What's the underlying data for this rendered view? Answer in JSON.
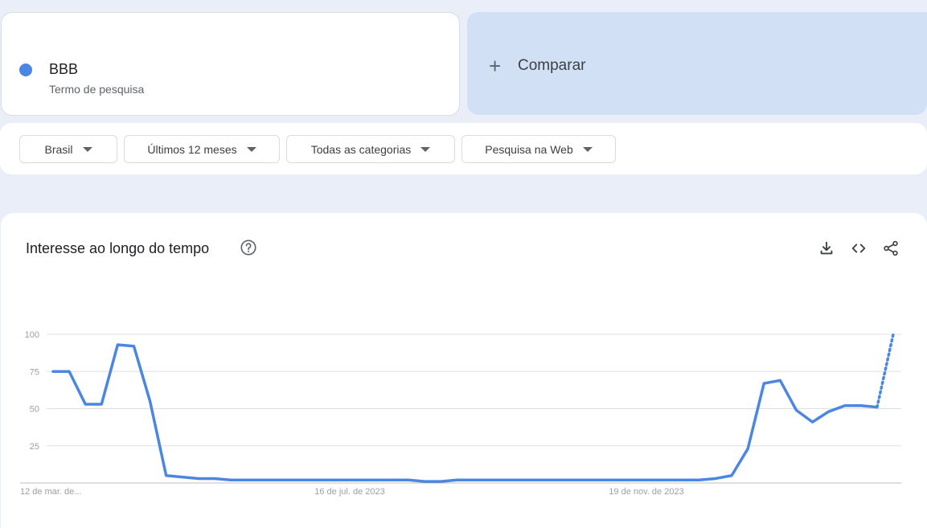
{
  "term": {
    "name": "BBB",
    "subtitle": "Termo de pesquisa",
    "color": "#4b86e2"
  },
  "compare": {
    "label": "Comparar"
  },
  "filters": [
    {
      "label": "Brasil"
    },
    {
      "label": "Últimos 12 meses"
    },
    {
      "label": "Todas as categorias"
    },
    {
      "label": "Pesquisa na Web"
    }
  ],
  "panel": {
    "title": "Interesse ao longo do tempo",
    "icons": [
      "help-circle-icon",
      "download-icon",
      "embed-code-icon",
      "share-icon"
    ]
  },
  "chart_data": {
    "type": "line",
    "ylim": [
      0,
      100
    ],
    "yticks": [
      25,
      50,
      75,
      100
    ],
    "grid": true,
    "xtick_labels": [
      "12 de mar. de...",
      "16 de jul. de 2023",
      "19 de nov. de 2023"
    ],
    "series": [
      {
        "color": "#4b86e2",
        "values": [
          75,
          75,
          53,
          53,
          93,
          92,
          55,
          5,
          4,
          3,
          3,
          2,
          2,
          2,
          2,
          2,
          2,
          2,
          2,
          2,
          2,
          2,
          2,
          1,
          1,
          2,
          2,
          2,
          2,
          2,
          2,
          2,
          2,
          2,
          2,
          2,
          2,
          2,
          2,
          2,
          2,
          3,
          5,
          23,
          67,
          69,
          49,
          41,
          48,
          52,
          52,
          51,
          100
        ],
        "partial_from_index": 51
      }
    ]
  }
}
